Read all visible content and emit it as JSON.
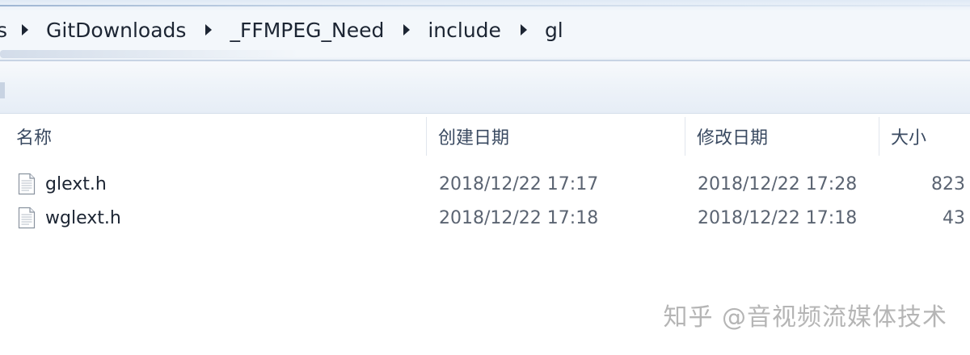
{
  "breadcrumb": {
    "items": [
      "s",
      "GitDownloads",
      "_FFMPEG_Need",
      "include",
      "gl"
    ]
  },
  "columns": {
    "name": "名称",
    "created": "创建日期",
    "modified": "修改日期",
    "size": "大小"
  },
  "files": [
    {
      "name": "glext.h",
      "created": "2018/12/22 17:17",
      "modified": "2018/12/22 17:28",
      "size": "823",
      "icon": "text-file-icon"
    },
    {
      "name": "wglext.h",
      "created": "2018/12/22 17:18",
      "modified": "2018/12/22 17:18",
      "size": "43",
      "icon": "text-file-icon"
    }
  ],
  "watermark": "知乎 @音视频流媒体技术",
  "colors": {
    "breadcrumb_bg": "#f3f7fb",
    "header_text": "#3a4a61",
    "row_text": "#1c2533",
    "date_text": "#5b6472"
  }
}
